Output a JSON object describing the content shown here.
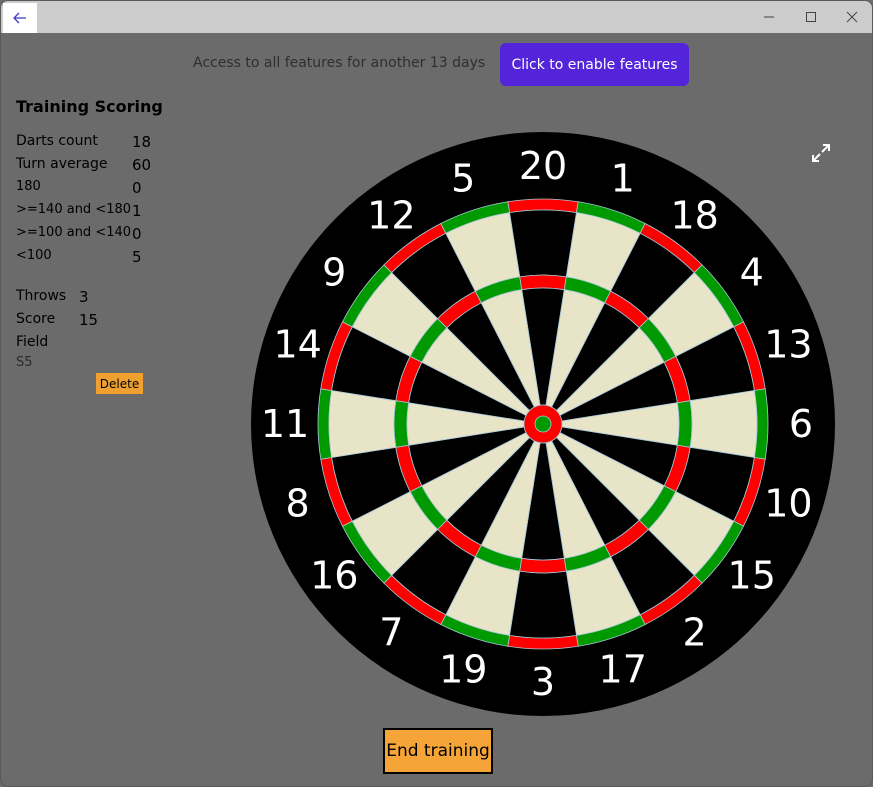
{
  "titlebar": {
    "back_icon": "arrow-left-icon",
    "controls": [
      "minimize-icon",
      "maximize-icon",
      "close-icon"
    ]
  },
  "trial": {
    "message": "Access to all features for another 13 days",
    "button_label": "Click to enable features",
    "button_color": "#5324d9"
  },
  "training": {
    "title": "Training Scoring",
    "stats": [
      {
        "label": "Darts count",
        "value": "18"
      },
      {
        "label": "Turn average",
        "value": "60"
      },
      {
        "label": "180",
        "value": "0"
      },
      {
        "label": ">=140 and <180",
        "value": "1"
      },
      {
        "label": ">=100 and <140",
        "value": "0"
      },
      {
        "label": "<100",
        "value": "5"
      }
    ],
    "throws_label": "Throws",
    "throws_value": "3",
    "score_label": "Score",
    "score_value": "15",
    "field_label": "Field",
    "field_value": "S5",
    "delete_label": "Delete"
  },
  "dartboard": {
    "numbers": [
      "20",
      "1",
      "18",
      "4",
      "13",
      "6",
      "10",
      "15",
      "2",
      "17",
      "3",
      "19",
      "7",
      "16",
      "8",
      "11",
      "14",
      "9",
      "12",
      "5"
    ],
    "colors": {
      "black": "#000000",
      "cream": "#e8e4c8",
      "red": "#ff0000",
      "green": "#009a00"
    },
    "expand_icon": "expand-icon"
  },
  "end_training_label": "End training"
}
